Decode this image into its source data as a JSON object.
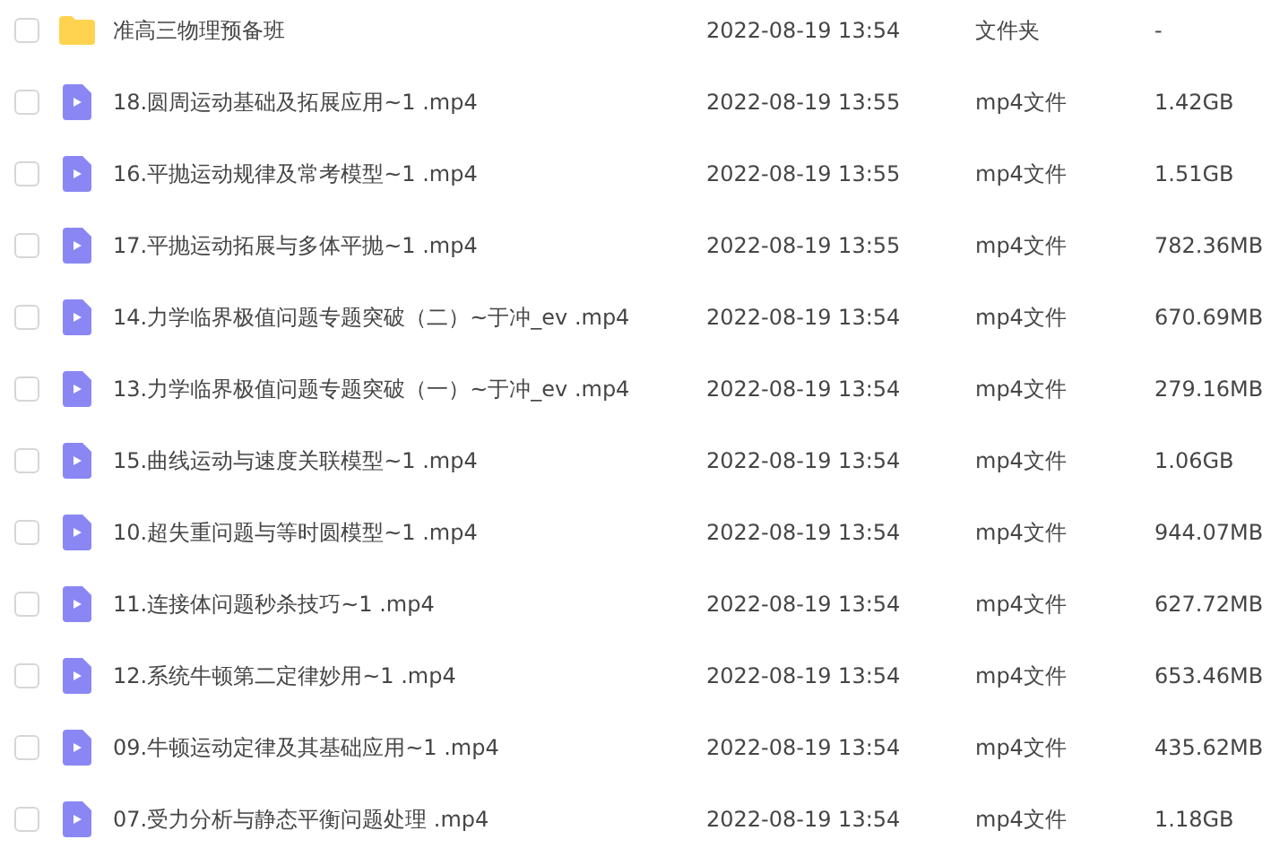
{
  "files": [
    {
      "kind": "folder",
      "name": "准高三物理预备班",
      "modified": "2022-08-19 13:54",
      "type": "文件夹",
      "size": "-",
      "checked": false
    },
    {
      "kind": "video",
      "name": "18.圆周运动基础及拓展应用~1 .mp4",
      "modified": "2022-08-19 13:55",
      "type": "mp4文件",
      "size": "1.42GB",
      "checked": false
    },
    {
      "kind": "video",
      "name": "16.平抛运动规律及常考模型~1 .mp4",
      "modified": "2022-08-19 13:55",
      "type": "mp4文件",
      "size": "1.51GB",
      "checked": false
    },
    {
      "kind": "video",
      "name": "17.平抛运动拓展与多体平抛~1 .mp4",
      "modified": "2022-08-19 13:55",
      "type": "mp4文件",
      "size": "782.36MB",
      "checked": false
    },
    {
      "kind": "video",
      "name": "14.力学临界极值问题专题突破（二）~于冲_ev .mp4",
      "modified": "2022-08-19 13:54",
      "type": "mp4文件",
      "size": "670.69MB",
      "checked": false
    },
    {
      "kind": "video",
      "name": "13.力学临界极值问题专题突破（一）~于冲_ev .mp4",
      "modified": "2022-08-19 13:54",
      "type": "mp4文件",
      "size": "279.16MB",
      "checked": false
    },
    {
      "kind": "video",
      "name": "15.曲线运动与速度关联模型~1 .mp4",
      "modified": "2022-08-19 13:54",
      "type": "mp4文件",
      "size": "1.06GB",
      "checked": false
    },
    {
      "kind": "video",
      "name": "10.超失重问题与等时圆模型~1 .mp4",
      "modified": "2022-08-19 13:54",
      "type": "mp4文件",
      "size": "944.07MB",
      "checked": false
    },
    {
      "kind": "video",
      "name": "11.连接体问题秒杀技巧~1 .mp4",
      "modified": "2022-08-19 13:54",
      "type": "mp4文件",
      "size": "627.72MB",
      "checked": false
    },
    {
      "kind": "video",
      "name": "12.系统牛顿第二定律妙用~1 .mp4",
      "modified": "2022-08-19 13:54",
      "type": "mp4文件",
      "size": "653.46MB",
      "checked": false
    },
    {
      "kind": "video",
      "name": "09.牛顿运动定律及其基础应用~1 .mp4",
      "modified": "2022-08-19 13:54",
      "type": "mp4文件",
      "size": "435.62MB",
      "checked": false
    },
    {
      "kind": "video",
      "name": "07.受力分析与静态平衡问题处理 .mp4",
      "modified": "2022-08-19 13:54",
      "type": "mp4文件",
      "size": "1.18GB",
      "checked": false
    }
  ]
}
